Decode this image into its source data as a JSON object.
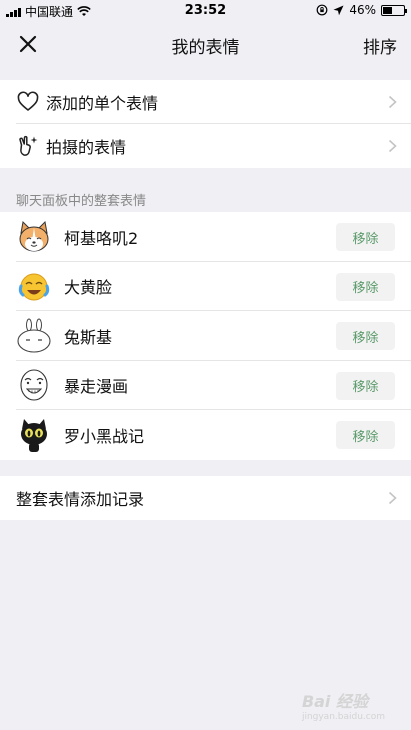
{
  "status_bar": {
    "carrier": "中国联通",
    "time": "23:52",
    "battery_text": "46%",
    "battery_level": 0.46,
    "icons": [
      "signal-icon",
      "wifi-icon",
      "rotation-lock-icon",
      "location-icon",
      "battery-icon"
    ]
  },
  "nav": {
    "title": "我的表情",
    "sort_label": "排序",
    "close_icon": "close-icon"
  },
  "top_group": {
    "items": [
      {
        "label": "添加的单个表情",
        "icon": "heart-icon"
      },
      {
        "label": "拍摄的表情",
        "icon": "hand-sparkle-icon"
      }
    ]
  },
  "packs_section": {
    "title": "聊天面板中的整套表情",
    "remove_label": "移除",
    "packs": [
      {
        "name": "柯基咯叽2",
        "icon": "corgi-thumb"
      },
      {
        "name": "大黄脸",
        "icon": "yellow-face-thumb"
      },
      {
        "name": "兔斯基",
        "icon": "rabbit-thumb"
      },
      {
        "name": "暴走漫画",
        "icon": "rage-comic-thumb"
      },
      {
        "name": "罗小黑战记",
        "icon": "black-cat-thumb"
      }
    ]
  },
  "history": {
    "label": "整套表情添加记录"
  },
  "watermark": {
    "text": "Bai 经验",
    "sub": "jingyan.baidu.com"
  },
  "colors": {
    "background": "#efeff4",
    "remove_text": "#5a9a6a",
    "remove_bg": "#f2f2f2"
  }
}
